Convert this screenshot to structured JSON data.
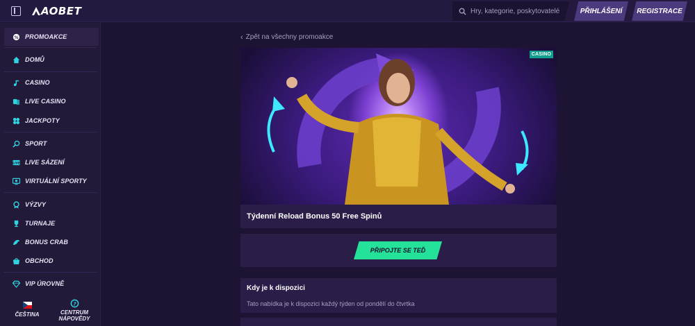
{
  "header": {
    "logo_text": "AOBET",
    "search_placeholder": "Hry, kategorie, poskytovatelé",
    "login_label": "PŘIHLÁŠENÍ",
    "register_label": "REGISTRACE"
  },
  "sidebar": {
    "items": [
      {
        "label": "PROMOAKCE",
        "icon": "promo-icon"
      },
      {
        "label": "DOMŮ",
        "icon": "home-icon"
      },
      {
        "label": "CASINO",
        "icon": "casino-icon"
      },
      {
        "label": "LIVE CASINO",
        "icon": "live-casino-icon"
      },
      {
        "label": "JACKPOTY",
        "icon": "jackpot-icon"
      },
      {
        "label": "SPORT",
        "icon": "sport-icon"
      },
      {
        "label": "LIVE SÁZENÍ",
        "icon": "live-betting-icon"
      },
      {
        "label": "VIRTUÁLNÍ SPORTY",
        "icon": "virtual-sports-icon"
      },
      {
        "label": "VÝZVY",
        "icon": "challenges-icon"
      },
      {
        "label": "TURNAJE",
        "icon": "tournaments-icon"
      },
      {
        "label": "BONUS CRAB",
        "icon": "bonus-crab-icon"
      },
      {
        "label": "OBCHOD",
        "icon": "shop-icon"
      },
      {
        "label": "VIP ÚROVNĚ",
        "icon": "vip-icon"
      }
    ],
    "language_label": "ČEŠTINA",
    "help_label_1": "CENTRUM",
    "help_label_2": "NÁPOVĚDY"
  },
  "main": {
    "back_label": "Zpět na všechny promoakce",
    "badge": "CASINO",
    "promo_title": "Týdenní Reload Bonus 50 Free Spinů",
    "cta_label": "PŘIPOJTE SE TEĎ",
    "availability_title": "Kdy je k dispozici",
    "availability_text": "Tato nabídka je k dispozici každý týden od pondělí do čtvrtka"
  },
  "colors": {
    "accent_green": "#25e29a",
    "badge_teal": "#129e8c",
    "header_button": "#4b3a7e",
    "background": "#1d1433"
  }
}
